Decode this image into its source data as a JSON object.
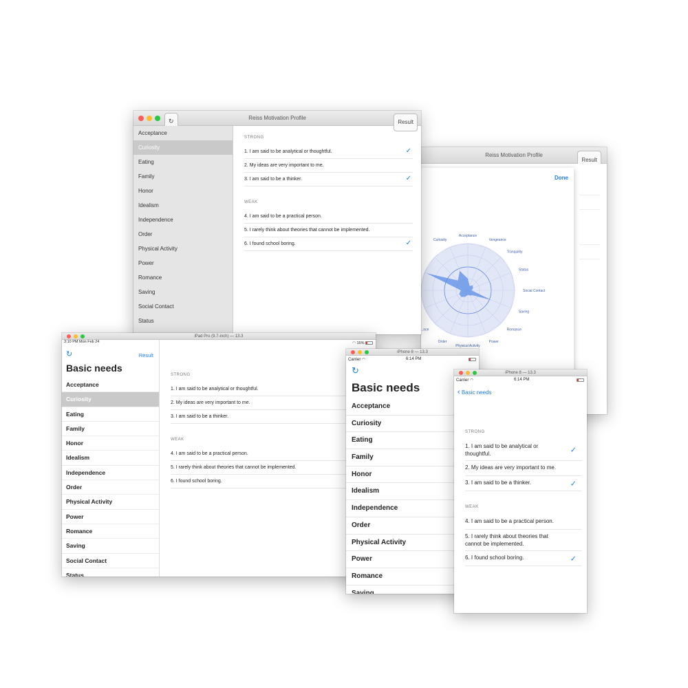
{
  "mac": {
    "title": "Reiss Motivation Profile",
    "result_button": "Result",
    "sidebar": [
      "Acceptance",
      "Curiosity",
      "Eating",
      "Family",
      "Honor",
      "Idealism",
      "Independence",
      "Order",
      "Physical Activity",
      "Power",
      "Romance",
      "Saving",
      "Social Contact",
      "Status"
    ],
    "selected": "Curiosity"
  },
  "strong_label": "STRONG",
  "weak_label": "WEAK",
  "statements": [
    {
      "text": "1. I am said to be analytical or thoughtful.",
      "checked": true
    },
    {
      "text": "2. My ideas are very important to me.",
      "checked": false
    },
    {
      "text": "3. I am said to be a thinker.",
      "checked": true
    },
    {
      "text": "4. I am said to be a practical person.",
      "checked": false
    },
    {
      "text": "5. I rarely think about theories that cannot be implemented.",
      "checked": false
    },
    {
      "text": "6. I found school boring.",
      "checked": true
    }
  ],
  "chart_window": {
    "title": "Reiss Motivation Profile",
    "result_button": "Result",
    "done_button": "Done",
    "chart_data": {
      "type": "radar",
      "categories": [
        "Acceptance",
        "Vengeance",
        "Tranquility",
        "Status",
        "Social Contact",
        "Saving",
        "Romance",
        "Power",
        "Physical Activity",
        "Order",
        "...nce",
        "",
        "",
        "...ing",
        "",
        "Curiosity"
      ],
      "values": [
        0.25,
        0.1,
        0.15,
        0.12,
        0.08,
        0.55,
        0.15,
        0.12,
        0.1,
        0.15,
        0.2,
        0.2,
        0.15,
        0.95,
        0.3,
        0.45
      ],
      "rings": 4
    }
  },
  "ipad": {
    "title": "iPad Pro (9.7-inch) — 13.3",
    "status_time": "3:10 PM",
    "status_date": "Mon Feb 24",
    "battery": "15%",
    "result_button": "Result",
    "heading": "Basic needs",
    "items": [
      "Acceptance",
      "Curiosity",
      "Eating",
      "Family",
      "Honor",
      "Idealism",
      "Independence",
      "Order",
      "Physical Activity",
      "Power",
      "Romance",
      "Saving",
      "Social Contact",
      "Status"
    ],
    "selected": "Curiosity"
  },
  "iphone_list": {
    "title": "iPhone 8 — 13.3",
    "carrier": "Carrier",
    "time": "6:14 PM",
    "heading": "Basic needs",
    "items": [
      "Acceptance",
      "Curiosity",
      "Eating",
      "Family",
      "Honor",
      "Idealism",
      "Independence",
      "Order",
      "Physical Activity",
      "Power",
      "Romance",
      "Saving"
    ]
  },
  "iphone_detail": {
    "title": "iPhone 8 — 13.3",
    "carrier": "Carrier",
    "time": "6:14 PM",
    "back_label": "Basic needs",
    "statements": [
      {
        "text": "1. I am said to be analytical or thoughtful.",
        "checked": true
      },
      {
        "text": "2. My ideas are very important to me.",
        "checked": false
      },
      {
        "text": "3. I am said to be a thinker.",
        "checked": true
      },
      {
        "text": "4. I am said to be a practical person.",
        "checked": false
      },
      {
        "text": "5. I rarely think about theories that cannot be implemented.",
        "checked": false
      },
      {
        "text": "6. I found school boring.",
        "checked": true
      }
    ]
  },
  "colors": {
    "accent": "#1e7cf2",
    "selection": "#c9c9c9",
    "chart_fill": "#5b8ee6",
    "chart_grid": "#d7dcf0"
  },
  "icons": [
    "refresh-icon",
    "checkmark-icon",
    "chevron-left-icon",
    "wifi-icon",
    "battery-icon"
  ]
}
